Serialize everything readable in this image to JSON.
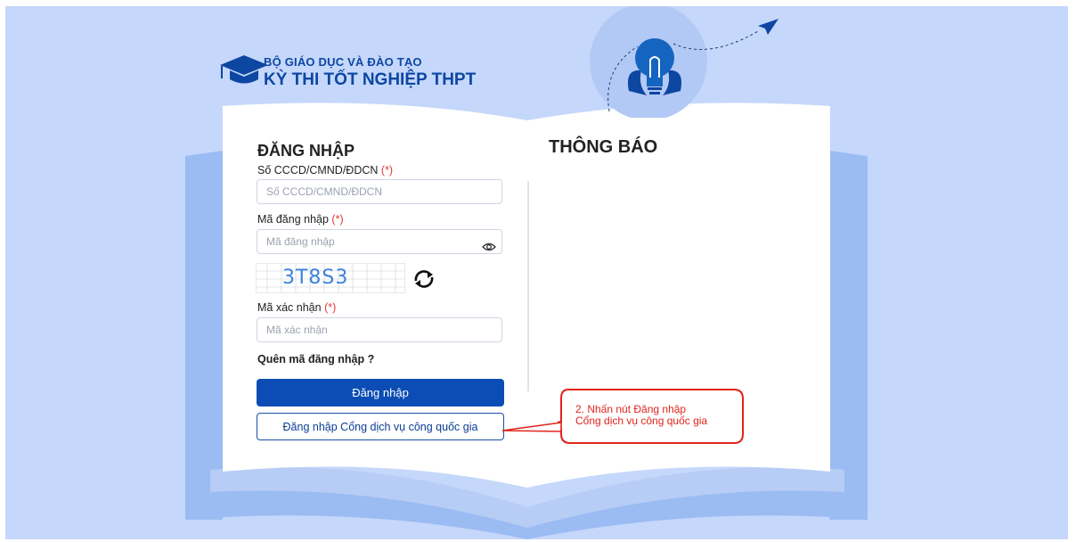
{
  "header": {
    "ministry": "BỘ GIÁO DỤC VÀ ĐÀO TẠO",
    "exam": "KỲ THI TỐT NGHIỆP THPT"
  },
  "login": {
    "title": "ĐĂNG NHẬP",
    "id_label": "Số CCCD/CMND/ĐDCN",
    "id_placeholder": "Số CCCD/CMND/ĐDCN",
    "code_label": "Mã đăng nhập",
    "code_placeholder": "Mã đăng nhập",
    "captcha_text": "3T8S3",
    "verify_label": "Mã xác nhận",
    "verify_placeholder": "Mã xác nhận",
    "required_mark": "(*)",
    "forgot": "Quên mã đăng nhập ?",
    "submit": "Đăng nhập",
    "national_portal": "Đăng nhập Cổng dịch vụ công quốc gia"
  },
  "notice": {
    "title": "THÔNG BÁO"
  },
  "annotation": {
    "line1": "2. Nhấn nút Đăng nhập",
    "line2": "Cổng dịch vụ công quốc gia"
  },
  "colors": {
    "background": "#c5d7fb",
    "primary": "#0b4db4",
    "brand": "#0d47a1",
    "required": "#e53935",
    "callout": "#e0241b"
  },
  "icons": [
    "graduation-cap-icon",
    "lightbulb-icon",
    "paper-plane-icon",
    "eye-icon",
    "refresh-icon"
  ]
}
